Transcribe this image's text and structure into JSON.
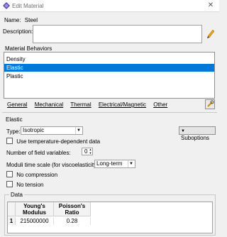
{
  "window": {
    "title": "Edit Material",
    "close_glyph": "✕"
  },
  "material": {
    "name_label": "Name:",
    "name_value": "Steel",
    "description_label": "Description:",
    "description_value": ""
  },
  "behaviors": {
    "group_label": "Material Behaviors",
    "items": [
      "Density",
      "Elastic",
      "Plastic"
    ],
    "selected": "Elastic"
  },
  "menu": [
    "General",
    "Mechanical",
    "Thermal",
    "Electrical/Magnetic",
    "Other"
  ],
  "elastic": {
    "section_label": "Elastic",
    "type_label": "Type:",
    "type_value": "Isotropic",
    "suboptions_label": "Suboptions",
    "use_temp_label": "Use temperature-dependent data",
    "field_vars_label": "Number of field variables:",
    "field_vars_value": "0",
    "moduli_label": "Moduli time scale (for viscoelasticity):",
    "moduli_value": "Long-term",
    "no_compression_label": "No compression",
    "no_tension_label": "No tension"
  },
  "data": {
    "group_label": "Data",
    "headers": [
      "Young's Modulus",
      "Poisson's Ratio"
    ],
    "rows": [
      {
        "index": "1",
        "values": [
          "215000000",
          "0.28"
        ]
      }
    ]
  },
  "icons": [
    "material-app-icon",
    "pencil-edit-icon",
    "wrench-icon",
    "triangle-down-icon"
  ]
}
